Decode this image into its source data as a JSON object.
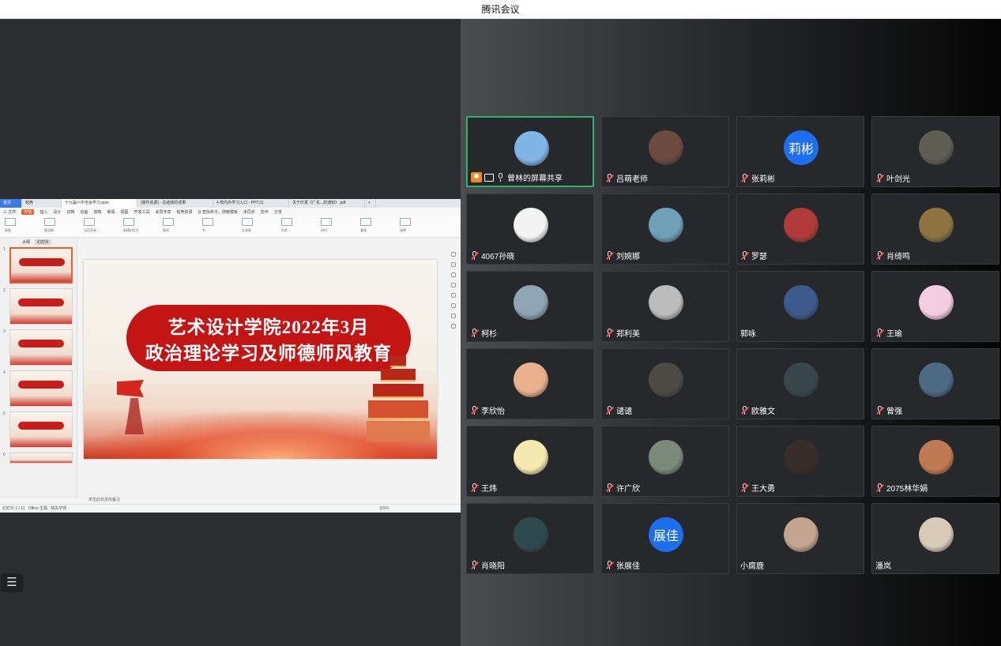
{
  "window": {
    "title": "腾讯会议"
  },
  "shared_screen": {
    "tabs": [
      "首页",
      "稻壳",
      "十九届六中全会学习.pptx",
      "[课件资源] - 总结我的成果",
      "4.校内外学习入口 - PPT(1)",
      "关于印发《广东...的通知》.pdf",
      "+"
    ],
    "menu": [
      "三 文件",
      "开始",
      "插入",
      "设计",
      "切换",
      "动画",
      "放映",
      "审阅",
      "视图",
      "开发工具",
      "会员专享",
      "稻壳资源",
      "Q 查找命令、搜索模板",
      "未同步",
      "协作",
      "分享"
    ],
    "active_menu": "开始",
    "ribbon_labels": [
      "粘贴",
      "格式刷",
      "当页开始",
      "新建幻灯片",
      "版式",
      "节",
      "文本框",
      "形状",
      "排列",
      "查找",
      "选择"
    ],
    "thumb_tabs": [
      "大纲",
      "幻灯片"
    ],
    "slide_numbers": [
      "1",
      "2",
      "3",
      "4",
      "5",
      "6"
    ],
    "slide": {
      "line1": "艺术设计学院2022年3月",
      "line2": "政治理论学习及师德师风教育"
    },
    "notes_placeholder": "单击此处添加备注",
    "status": {
      "page": "幻灯片 1 / 11",
      "theme": "Office 主题",
      "font_missing": "缺失字体",
      "zoom": "115%"
    }
  },
  "participants": [
    {
      "name": "曾林的屏幕共享",
      "sharing": true,
      "avatar_text": "",
      "avatar_color": "#7fb6e6",
      "muted": false
    },
    {
      "name": "吕萌老师",
      "avatar_text": "",
      "avatar_color": "#6b4a40",
      "muted": true
    },
    {
      "name": "张莉彬",
      "avatar_text": "莉彬",
      "avatar_color": "#1e6ff0",
      "muted": true
    },
    {
      "name": "叶剑光",
      "avatar_text": "",
      "avatar_color": "#5e5f52",
      "muted": true
    },
    {
      "name": "4067孙晓",
      "avatar_text": "",
      "avatar_color": "#f4f4f4",
      "muted": true
    },
    {
      "name": "刘婉娜",
      "avatar_text": "",
      "avatar_color": "#6ea0b7",
      "muted": true
    },
    {
      "name": "罗瑟",
      "avatar_text": "",
      "avatar_color": "#b13a3a",
      "muted": true
    },
    {
      "name": "肖绮鸣",
      "avatar_text": "",
      "avatar_color": "#8c7340",
      "muted": true
    },
    {
      "name": "柯杉",
      "avatar_text": "",
      "avatar_color": "#8fa4b4",
      "muted": true
    },
    {
      "name": "郑利美",
      "avatar_text": "",
      "avatar_color": "#bcbcbc",
      "muted": true
    },
    {
      "name": "郭咏",
      "avatar_text": "",
      "avatar_color": "#3c5a8c",
      "muted": false
    },
    {
      "name": "王瑜",
      "avatar_text": "",
      "avatar_color": "#f5cde0",
      "muted": true
    },
    {
      "name": "李欣怡",
      "avatar_text": "",
      "avatar_color": "#e8b08c",
      "muted": true
    },
    {
      "name": "谴谴",
      "avatar_text": "",
      "avatar_color": "#4e4a45",
      "muted": true
    },
    {
      "name": "欧雅文",
      "avatar_text": "",
      "avatar_color": "#39474d",
      "muted": true
    },
    {
      "name": "曾强",
      "avatar_text": "",
      "avatar_color": "#4d6a86",
      "muted": true
    },
    {
      "name": "王炜",
      "avatar_text": "",
      "avatar_color": "#f4e9b0",
      "muted": true
    },
    {
      "name": "许广欣",
      "avatar_text": "",
      "avatar_color": "#7b8a7a",
      "muted": true
    },
    {
      "name": "王大勇",
      "avatar_text": "",
      "avatar_color": "#3a2e2a",
      "muted": true
    },
    {
      "name": "2075林华娟",
      "avatar_text": "",
      "avatar_color": "#c07a53",
      "muted": true
    },
    {
      "name": "肖晓阳",
      "avatar_text": "",
      "avatar_color": "#2f4a4f",
      "muted": true
    },
    {
      "name": "张展佳",
      "avatar_text": "展佳",
      "avatar_color": "#1e6ff0",
      "muted": true
    },
    {
      "name": "小腐鹿",
      "avatar_text": "",
      "avatar_color": "#c3a592",
      "muted": false
    },
    {
      "name": "潘岚",
      "avatar_text": "",
      "avatar_color": "#d8cbb8",
      "muted": false
    }
  ],
  "colors": {
    "speaking_border": "#2fb36b",
    "muted_slash": "#ff4d4f",
    "brand_blue": "#1e6ff0"
  }
}
